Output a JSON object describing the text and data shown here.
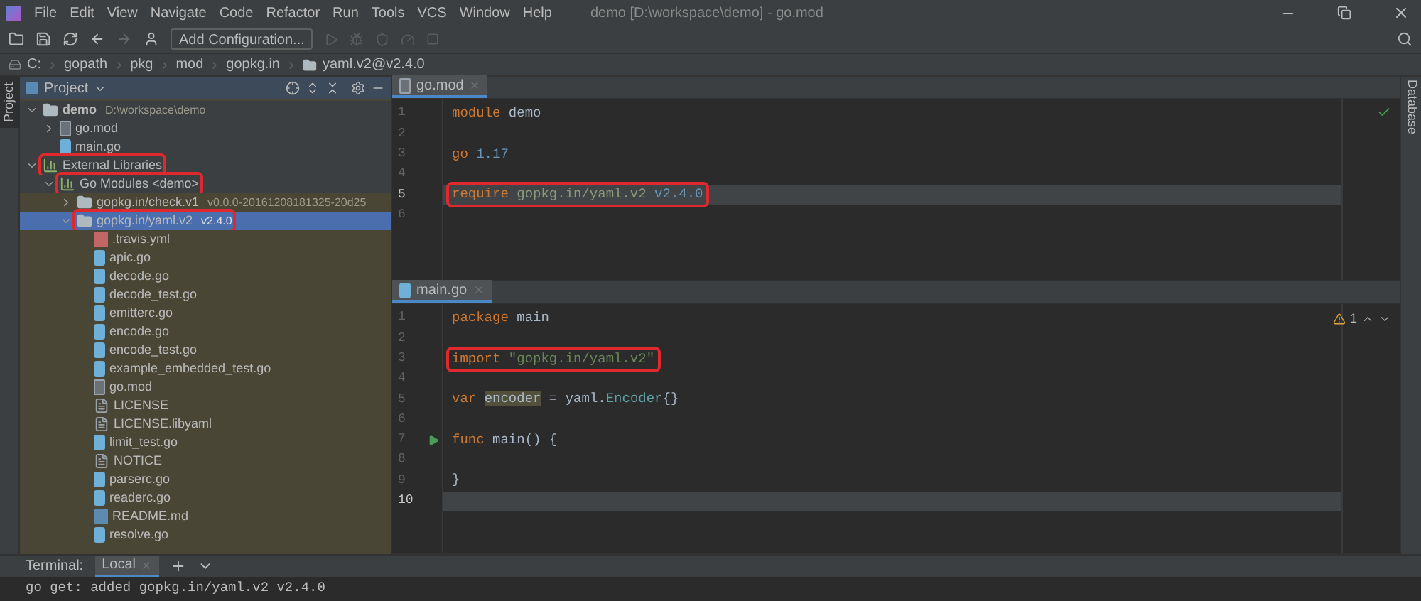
{
  "window": {
    "title": "demo [D:\\workspace\\demo] - go.mod"
  },
  "menu": [
    "File",
    "Edit",
    "View",
    "Navigate",
    "Code",
    "Refactor",
    "Run",
    "Tools",
    "VCS",
    "Window",
    "Help"
  ],
  "toolbar": {
    "run_config": "Add Configuration..."
  },
  "breadcrumb": [
    {
      "label": "C:",
      "kind": "drive"
    },
    {
      "label": "gopath",
      "kind": "dir"
    },
    {
      "label": "pkg",
      "kind": "dir"
    },
    {
      "label": "mod",
      "kind": "dir"
    },
    {
      "label": "gopkg.in",
      "kind": "dir"
    },
    {
      "label": "yaml.v2@v2.4.0",
      "kind": "folder"
    }
  ],
  "left_strip": {
    "label": "Project"
  },
  "right_strip": {
    "label": "Database"
  },
  "project_panel": {
    "title": "Project",
    "tree": [
      {
        "label": "demo",
        "hint": "D:\\workspace\\demo",
        "kind": "folder",
        "expanded": true,
        "selected": false,
        "highlighted": false,
        "children": [
          {
            "label": "go.mod",
            "kind": "mod",
            "expanded": false,
            "selected": false,
            "highlighted": false
          },
          {
            "label": "main.go",
            "kind": "go",
            "selected": false,
            "highlighted": false
          }
        ]
      },
      {
        "label": "External Libraries",
        "kind": "lib",
        "expanded": true,
        "selected": false,
        "highlighted": true,
        "children": [
          {
            "label": "Go Modules <demo>",
            "kind": "lib",
            "expanded": true,
            "selected": false,
            "highlighted": true,
            "children": [
              {
                "label": "gopkg.in/check.v1",
                "hint": "v0.0.0-20161208181325-20d25",
                "kind": "folder",
                "expanded": false,
                "selected": false,
                "highlighted": false
              },
              {
                "label": "gopkg.in/yaml.v2",
                "hint": "v2.4.0",
                "kind": "folder",
                "expanded": true,
                "selected": true,
                "highlighted": true,
                "children": [
                  {
                    "label": ".travis.yml",
                    "kind": "yaml",
                    "selected": false,
                    "highlighted": false
                  },
                  {
                    "label": "apic.go",
                    "kind": "go",
                    "selected": false,
                    "highlighted": false
                  },
                  {
                    "label": "decode.go",
                    "kind": "go",
                    "selected": false,
                    "highlighted": false
                  },
                  {
                    "label": "decode_test.go",
                    "kind": "go",
                    "selected": false,
                    "highlighted": false
                  },
                  {
                    "label": "emitterc.go",
                    "kind": "go",
                    "selected": false,
                    "highlighted": false
                  },
                  {
                    "label": "encode.go",
                    "kind": "go",
                    "selected": false,
                    "highlighted": false
                  },
                  {
                    "label": "encode_test.go",
                    "kind": "go",
                    "selected": false,
                    "highlighted": false
                  },
                  {
                    "label": "example_embedded_test.go",
                    "kind": "go",
                    "selected": false,
                    "highlighted": false
                  },
                  {
                    "label": "go.mod",
                    "kind": "mod",
                    "selected": false,
                    "highlighted": false
                  },
                  {
                    "label": "LICENSE",
                    "kind": "text",
                    "selected": false,
                    "highlighted": false
                  },
                  {
                    "label": "LICENSE.libyaml",
                    "kind": "text",
                    "selected": false,
                    "highlighted": false
                  },
                  {
                    "label": "limit_test.go",
                    "kind": "go",
                    "selected": false,
                    "highlighted": false
                  },
                  {
                    "label": "NOTICE",
                    "kind": "text",
                    "selected": false,
                    "highlighted": false
                  },
                  {
                    "label": "parserc.go",
                    "kind": "go",
                    "selected": false,
                    "highlighted": false
                  },
                  {
                    "label": "readerc.go",
                    "kind": "go",
                    "selected": false,
                    "highlighted": false
                  },
                  {
                    "label": "README.md",
                    "kind": "md",
                    "selected": false,
                    "highlighted": false
                  },
                  {
                    "label": "resolve.go",
                    "kind": "go",
                    "selected": false,
                    "highlighted": false
                  }
                ]
              }
            ]
          }
        ]
      }
    ]
  },
  "editors": [
    {
      "tab": {
        "label": "go.mod",
        "kind": "mod"
      },
      "status": {
        "kind": "ok"
      },
      "lines": [
        {
          "number": "1",
          "current": false,
          "highlighted": false,
          "tokens": [
            {
              "text": "module",
              "kind": "keyword"
            },
            {
              "text": " demo",
              "kind": "plain"
            }
          ]
        },
        {
          "number": "2",
          "current": false,
          "highlighted": false
        },
        {
          "number": "3",
          "current": false,
          "highlighted": false,
          "tokens": [
            {
              "text": "go",
              "kind": "keyword"
            },
            {
              "text": " 1.17",
              "kind": "number"
            }
          ]
        },
        {
          "number": "4",
          "current": false,
          "highlighted": false
        },
        {
          "number": "5",
          "current": true,
          "highlighted": true,
          "tokens": [
            {
              "text": "require",
              "kind": "keyword"
            },
            {
              "text": " gopkg.in/yaml.v2",
              "kind": "path"
            },
            {
              "text": " v2.4.0",
              "kind": "number"
            }
          ]
        },
        {
          "number": "6",
          "current": false,
          "highlighted": false
        }
      ]
    },
    {
      "tab": {
        "label": "main.go",
        "kind": "go"
      },
      "status": {
        "kind": "warning",
        "count": "1"
      },
      "lines": [
        {
          "number": "1",
          "current": false,
          "highlighted": false,
          "tokens": [
            {
              "text": "package",
              "kind": "keyword"
            },
            {
              "text": " main",
              "kind": "plain"
            }
          ]
        },
        {
          "number": "2",
          "current": false,
          "highlighted": false
        },
        {
          "number": "3",
          "current": false,
          "highlighted": true,
          "tokens": [
            {
              "text": "import",
              "kind": "keyword"
            },
            {
              "text": " \"gopkg.in/yaml.v2\"",
              "kind": "string"
            }
          ]
        },
        {
          "number": "4",
          "current": false,
          "highlighted": false
        },
        {
          "number": "5",
          "current": false,
          "highlighted": false,
          "tokens": [
            {
              "text": "var ",
              "kind": "keyword"
            },
            {
              "text": "encoder",
              "kind": "usage"
            },
            {
              "text": " = yaml.",
              "kind": "plain"
            },
            {
              "text": "Encoder",
              "kind": "type"
            },
            {
              "text": "{}",
              "kind": "plain"
            }
          ]
        },
        {
          "number": "6",
          "current": false,
          "highlighted": false
        },
        {
          "number": "7",
          "current": false,
          "highlighted": false,
          "run": true,
          "tokens": [
            {
              "text": "func",
              "kind": "keyword"
            },
            {
              "text": " main() {",
              "kind": "plain"
            }
          ]
        },
        {
          "number": "8",
          "current": false,
          "highlighted": false
        },
        {
          "number": "9",
          "current": false,
          "highlighted": false,
          "tokens": [
            {
              "text": "}",
              "kind": "plain"
            }
          ]
        },
        {
          "number": "10",
          "current": true,
          "highlighted": false
        }
      ]
    }
  ],
  "terminal": {
    "title": "Terminal:",
    "tabs": [
      {
        "label": "Local",
        "selected": true
      }
    ],
    "output": "go get: added gopkg.in/yaml.v2 v2.4.0"
  }
}
